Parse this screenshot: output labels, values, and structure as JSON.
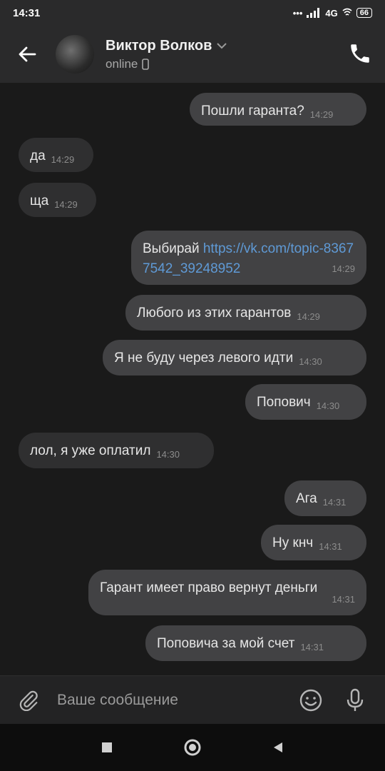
{
  "status_bar": {
    "time": "14:31",
    "network": "4G",
    "battery": "66"
  },
  "header": {
    "contact_name": "Виктор Волков",
    "status": "online",
    "icons": [
      "back-arrow-icon",
      "chevron-down-icon",
      "phone-icon",
      "mobile-device-icon"
    ]
  },
  "messages": [
    {
      "direction": "out",
      "text": "Пошли гаранта?",
      "time": "14:29"
    },
    {
      "direction": "in",
      "text": "да",
      "time": "14:29"
    },
    {
      "direction": "in",
      "text": "ща",
      "time": "14:29"
    },
    {
      "direction": "out",
      "text": "Выбирай ",
      "link": "https://vk.com/topic-83677542_39248952",
      "time": "14:29"
    },
    {
      "direction": "out",
      "text": "Любого из этих гарантов",
      "time": "14:29"
    },
    {
      "direction": "out",
      "text": "Я не буду через левого идти",
      "time": "14:30"
    },
    {
      "direction": "out",
      "text": "Попович",
      "time": "14:30"
    },
    {
      "direction": "in",
      "text": "лол, я уже оплатил",
      "time": "14:30"
    },
    {
      "direction": "out",
      "text": "Ага",
      "time": "14:31"
    },
    {
      "direction": "out",
      "text": "Ну кнч",
      "time": "14:31"
    },
    {
      "direction": "out",
      "text": "Гарант имеет право вернут деньги",
      "time": "14:31"
    },
    {
      "direction": "out",
      "text": "Поповича за мой счет",
      "time": "14:31"
    }
  ],
  "composer": {
    "placeholder": "Ваше сообщение",
    "icons": [
      "paperclip-icon",
      "emoji-icon",
      "microphone-icon"
    ]
  },
  "nav_bar": {
    "icons": [
      "square-recents-icon",
      "circle-home-icon",
      "triangle-back-icon"
    ]
  },
  "colors": {
    "background": "#1a1a1a",
    "header": "#2a2a2b",
    "outgoing_bubble": "#424244",
    "incoming_bubble": "#2f2f30",
    "link": "#5f9ad6",
    "timestamp": "#8c8c8c"
  }
}
